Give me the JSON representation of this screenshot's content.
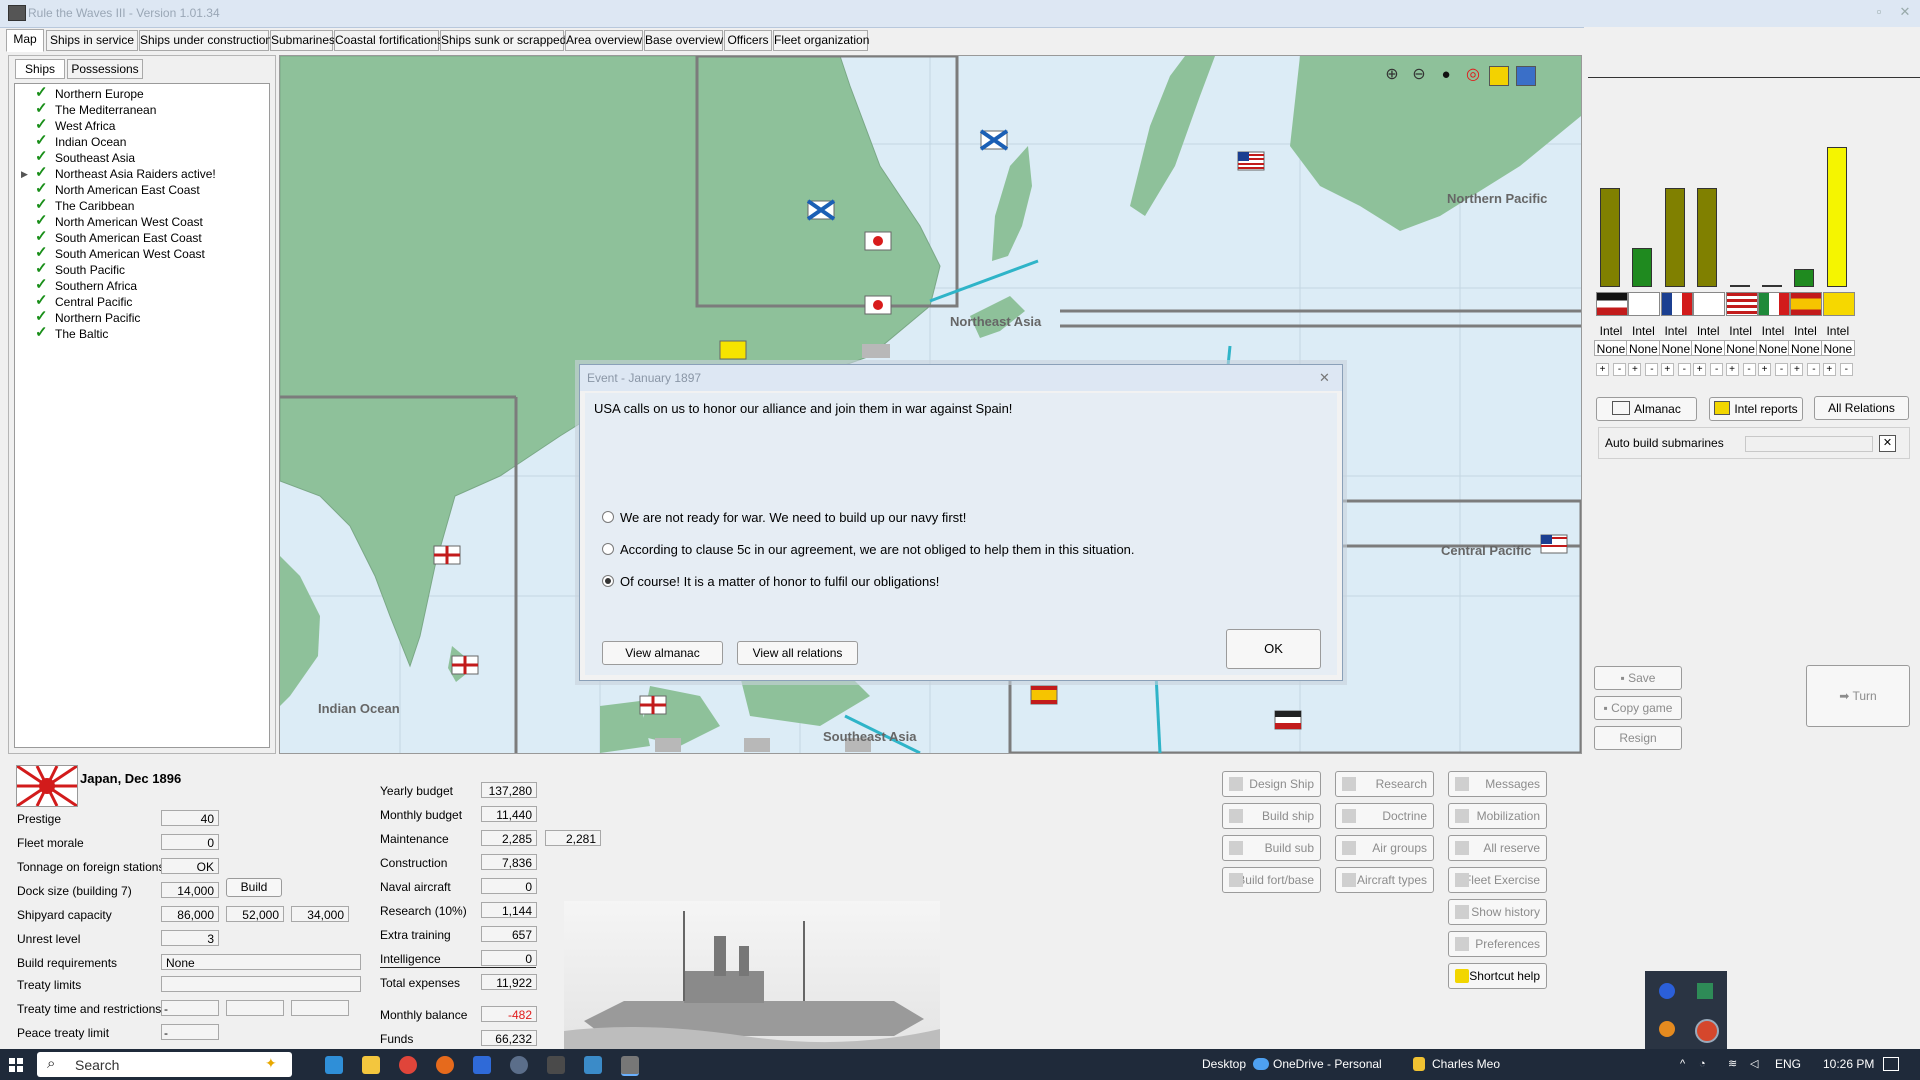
{
  "window": {
    "title": "Rule the Waves III - Version 1.01.34"
  },
  "tabs": [
    "Map",
    "Ships in service",
    "Ships under construction",
    "Submarines",
    "Coastal fortifications",
    "Ships sunk or scrapped",
    "Area overview",
    "Base overview",
    "Officers",
    "Fleet organization"
  ],
  "left_tabs": [
    "Ships",
    "Possessions"
  ],
  "regions": [
    "Northern Europe",
    "The Mediterranean",
    "West Africa",
    "Indian Ocean",
    "Southeast Asia",
    "Northeast Asia Raiders active!",
    "North American East Coast",
    "The Caribbean",
    "North American West Coast",
    "South American East Coast",
    "South American West Coast",
    "South Pacific",
    "Southern Africa",
    "Central Pacific",
    "Northern Pacific",
    "The Baltic"
  ],
  "map_labels": {
    "northern_pacific": "Northern Pacific",
    "northeast_asia": "Northeast Asia",
    "central_pacific": "Central Pacific",
    "indian_ocean": "Indian Ocean",
    "southeast_asia": "Southeast Asia"
  },
  "map_tools": [
    "zoom-in-icon",
    "zoom-out-icon",
    "oil-drop-icon",
    "target-icon",
    "flags-icon",
    "report-icon"
  ],
  "dialog": {
    "title": "Event - January 1897",
    "message": "USA calls on us to honor our alliance and join them in war against Spain!",
    "options": [
      {
        "label": "We are not ready for war. We need to build up our navy first!",
        "selected": false
      },
      {
        "label": "According to clause 5c in our agreement, we are not obliged to help them in this situation.",
        "selected": false
      },
      {
        "label": "Of course! It is a matter of honor to fulfil our obligations!",
        "selected": true
      }
    ],
    "view_almanac": "View almanac",
    "view_all_relations": "View all relations",
    "ok": "OK"
  },
  "nations": [
    {
      "flag": "germany",
      "intel": "Intel",
      "level": "None",
      "color": "#808000",
      "bar": 0.71
    },
    {
      "flag": "britain",
      "intel": "Intel",
      "level": "None",
      "color": "#1f8a1f",
      "bar": 0.28
    },
    {
      "flag": "france",
      "intel": "Intel",
      "level": "None",
      "color": "#808000",
      "bar": 0.71
    },
    {
      "flag": "russia",
      "intel": "Intel",
      "level": "None",
      "color": "#808000",
      "bar": 0.71
    },
    {
      "flag": "usa",
      "intel": "Intel",
      "level": "None",
      "color": "#808000",
      "bar": 0.0
    },
    {
      "flag": "italy",
      "intel": "Intel",
      "level": "None",
      "color": "#808000",
      "bar": 0.0
    },
    {
      "flag": "spain",
      "intel": "Intel",
      "level": "None",
      "color": "#1f8a1f",
      "bar": 0.13
    },
    {
      "flag": "china",
      "intel": "Intel",
      "level": "None",
      "color": "#f5f500",
      "bar": 1.0
    }
  ],
  "right_buttons": {
    "almanac": "Almanac",
    "intel_reports": "Intel reports",
    "all_relations": "All Relations",
    "auto_build": "Auto build submarines",
    "close_x": "✕",
    "save": "Save",
    "copy_game": "Copy game",
    "resign": "Resign",
    "turn": "Turn"
  },
  "nation_info": {
    "title": "Japan, Dec 1896",
    "rows": [
      {
        "label": "Prestige",
        "values": [
          "40"
        ]
      },
      {
        "label": "Fleet morale",
        "values": [
          "0"
        ]
      },
      {
        "label": "Tonnage on foreign stations",
        "values": [
          "OK"
        ]
      },
      {
        "label": "Dock size (building 7)",
        "values": [
          "14,000"
        ]
      },
      {
        "label": "Shipyard capacity",
        "values": [
          "86,000",
          "52,000",
          "34,000"
        ]
      },
      {
        "label": "Unrest level",
        "values": [
          "3"
        ]
      },
      {
        "label": "Build requirements",
        "values": [
          "None"
        ]
      },
      {
        "label": "Treaty limits",
        "values": [
          ""
        ]
      },
      {
        "label": "Treaty time and restrictions",
        "values": [
          "-",
          "",
          ""
        ]
      },
      {
        "label": "Peace treaty limit",
        "values": [
          "-"
        ]
      }
    ],
    "build_button": "Build"
  },
  "budget": {
    "rows": [
      {
        "label": "Yearly budget",
        "value": "137,280"
      },
      {
        "label": "Monthly budget",
        "value": "11,440"
      },
      {
        "label": "Maintenance",
        "value": "2,285",
        "extra": "2,281"
      },
      {
        "label": "Construction",
        "value": "7,836"
      },
      {
        "label": "Naval aircraft",
        "value": "0"
      },
      {
        "label": "Research (10%)",
        "value": "1,144"
      },
      {
        "label": "Extra training",
        "value": "657"
      },
      {
        "label": "Intelligence",
        "value": "0"
      },
      {
        "label": "Total expenses",
        "value": "11,922"
      },
      {
        "label": "Monthly balance",
        "value": "-482"
      },
      {
        "label": "Funds",
        "value": "66,232"
      }
    ]
  },
  "action_buttons": {
    "col1": [
      "Design Ship",
      "Build ship",
      "Build sub",
      "Build fort/base"
    ],
    "col2": [
      "Research",
      "Doctrine",
      "Air groups",
      "Aircraft types"
    ],
    "col3": [
      "Messages",
      "Mobilization",
      "All reserve",
      "Fleet Exercise",
      "Show history",
      "Preferences",
      "Shortcut help"
    ]
  },
  "taskbar": {
    "search": "Search",
    "desktop": "Desktop",
    "onedrive": "OneDrive - Personal",
    "user": "Charles Meo",
    "lang": "ENG",
    "time": "10:26 PM"
  }
}
